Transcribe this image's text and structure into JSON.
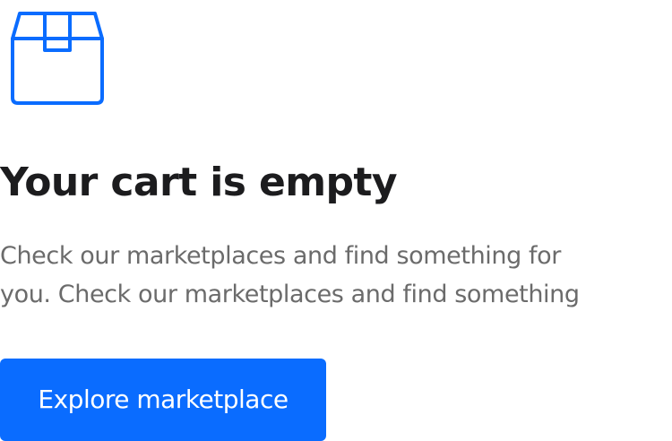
{
  "empty_state": {
    "icon": "package-box-icon",
    "accent_color": "#0a6cff",
    "title": "Your cart is empty",
    "description_lines": [
      "Check our marketplaces and find something for",
      "you. Check our marketplaces and find something"
    ],
    "cta_label": "Explore marketplace"
  }
}
